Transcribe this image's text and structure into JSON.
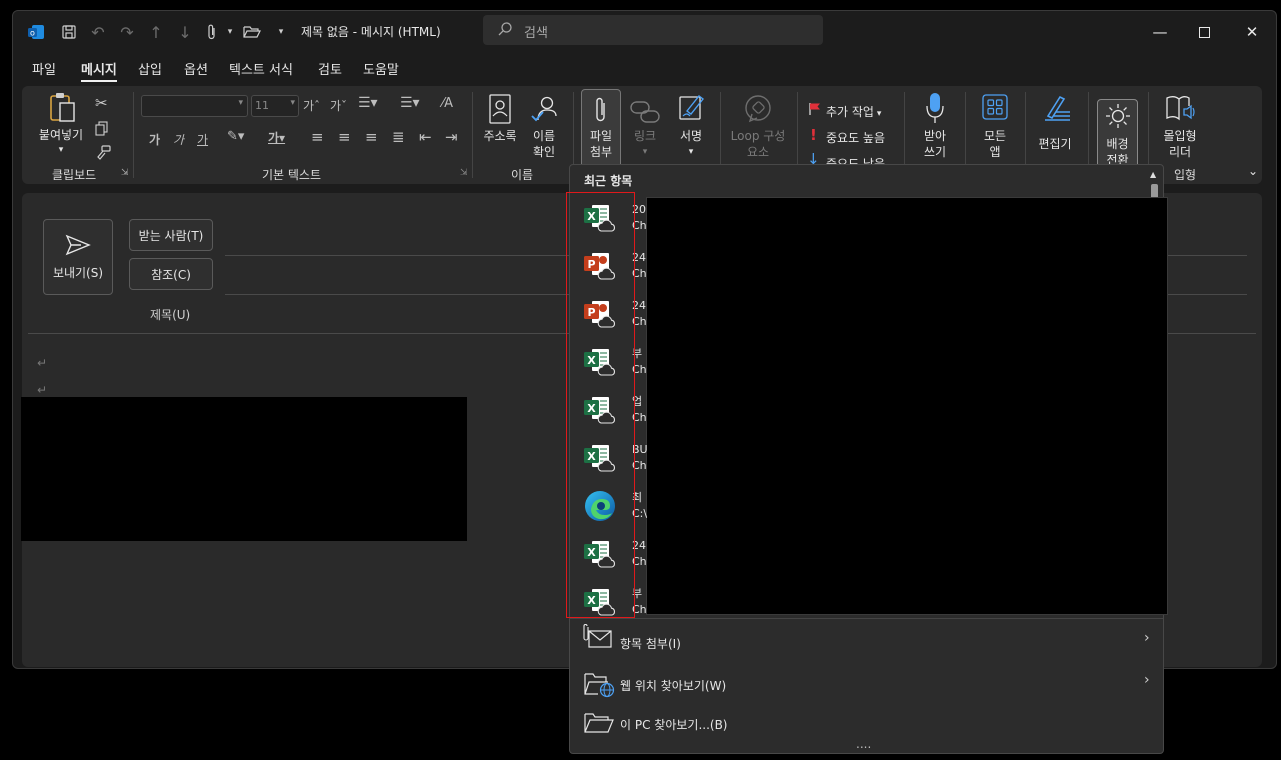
{
  "window": {
    "title": "제목 없음  -  메시지 (HTML)",
    "search_placeholder": "검색"
  },
  "tabs": [
    {
      "label": "파일",
      "active": false
    },
    {
      "label": "메시지",
      "active": true
    },
    {
      "label": "삽입",
      "active": false
    },
    {
      "label": "옵션",
      "active": false
    },
    {
      "label": "텍스트 서식",
      "active": false
    },
    {
      "label": "검토",
      "active": false
    },
    {
      "label": "도움말",
      "active": false
    }
  ],
  "ribbon": {
    "paste_label": "붙여넣기",
    "clipboard_group": "클립보드",
    "font_size": "11",
    "basic_text_group": "기본 텍스트",
    "address_book_label": "주소록",
    "check_names_line1": "이름",
    "check_names_line2": "확인",
    "names_group": "이름",
    "attach_file_line1": "파일",
    "attach_file_line2": "첨부",
    "link_label": "링크",
    "signature_label": "서명",
    "loop_line1": "Loop 구성",
    "loop_line2": "요소",
    "follow_up_label": "추가 작업",
    "high_importance_label": "중요도 높음",
    "low_importance_label": "중요도 낮음",
    "dictate_line1": "받아",
    "dictate_line2": "쓰기",
    "all_apps_line1": "모든",
    "all_apps_line2": "앱",
    "editor_label": "편집기",
    "background_line1": "배경",
    "background_line2": "전환",
    "immersive_line1": "몰입형",
    "immersive_line2": "리더",
    "immersive_group": "입형"
  },
  "compose": {
    "send_label": "보내기(S)",
    "to_label": "받는 사람(T)",
    "cc_label": "참조(C)",
    "subject_label": "제목(U)",
    "para_mark": "↵"
  },
  "attach_menu": {
    "recent_header": "최근 항목",
    "recent_files": [
      {
        "type": "excel",
        "line1": "20",
        "line2": "Ch"
      },
      {
        "type": "powerpoint",
        "line1": "24",
        "line2": "Ch"
      },
      {
        "type": "powerpoint",
        "line1": "24",
        "line2": "Ch"
      },
      {
        "type": "excel",
        "line1": "부",
        "line2": "Ch"
      },
      {
        "type": "excel",
        "line1": "업",
        "line2": "Ch"
      },
      {
        "type": "excel",
        "line1": "BU",
        "line2": "Ch"
      },
      {
        "type": "edge",
        "line1": "최",
        "line2": "C:\\"
      },
      {
        "type": "excel",
        "line1": "24",
        "line2": "Ch"
      },
      {
        "type": "excel",
        "line1": "부",
        "line2": "Ch"
      }
    ],
    "attach_item": "항목 첨부(I)",
    "browse_web": "웹 위치 찾아보기(W)",
    "browse_pc": "이 PC 찾아보기...(B)",
    "more": "...."
  },
  "colors": {
    "excel": "#1d7044",
    "powerpoint": "#c43e1c",
    "highlight_box": "#e0191b",
    "accent": "#4ea1f3"
  }
}
